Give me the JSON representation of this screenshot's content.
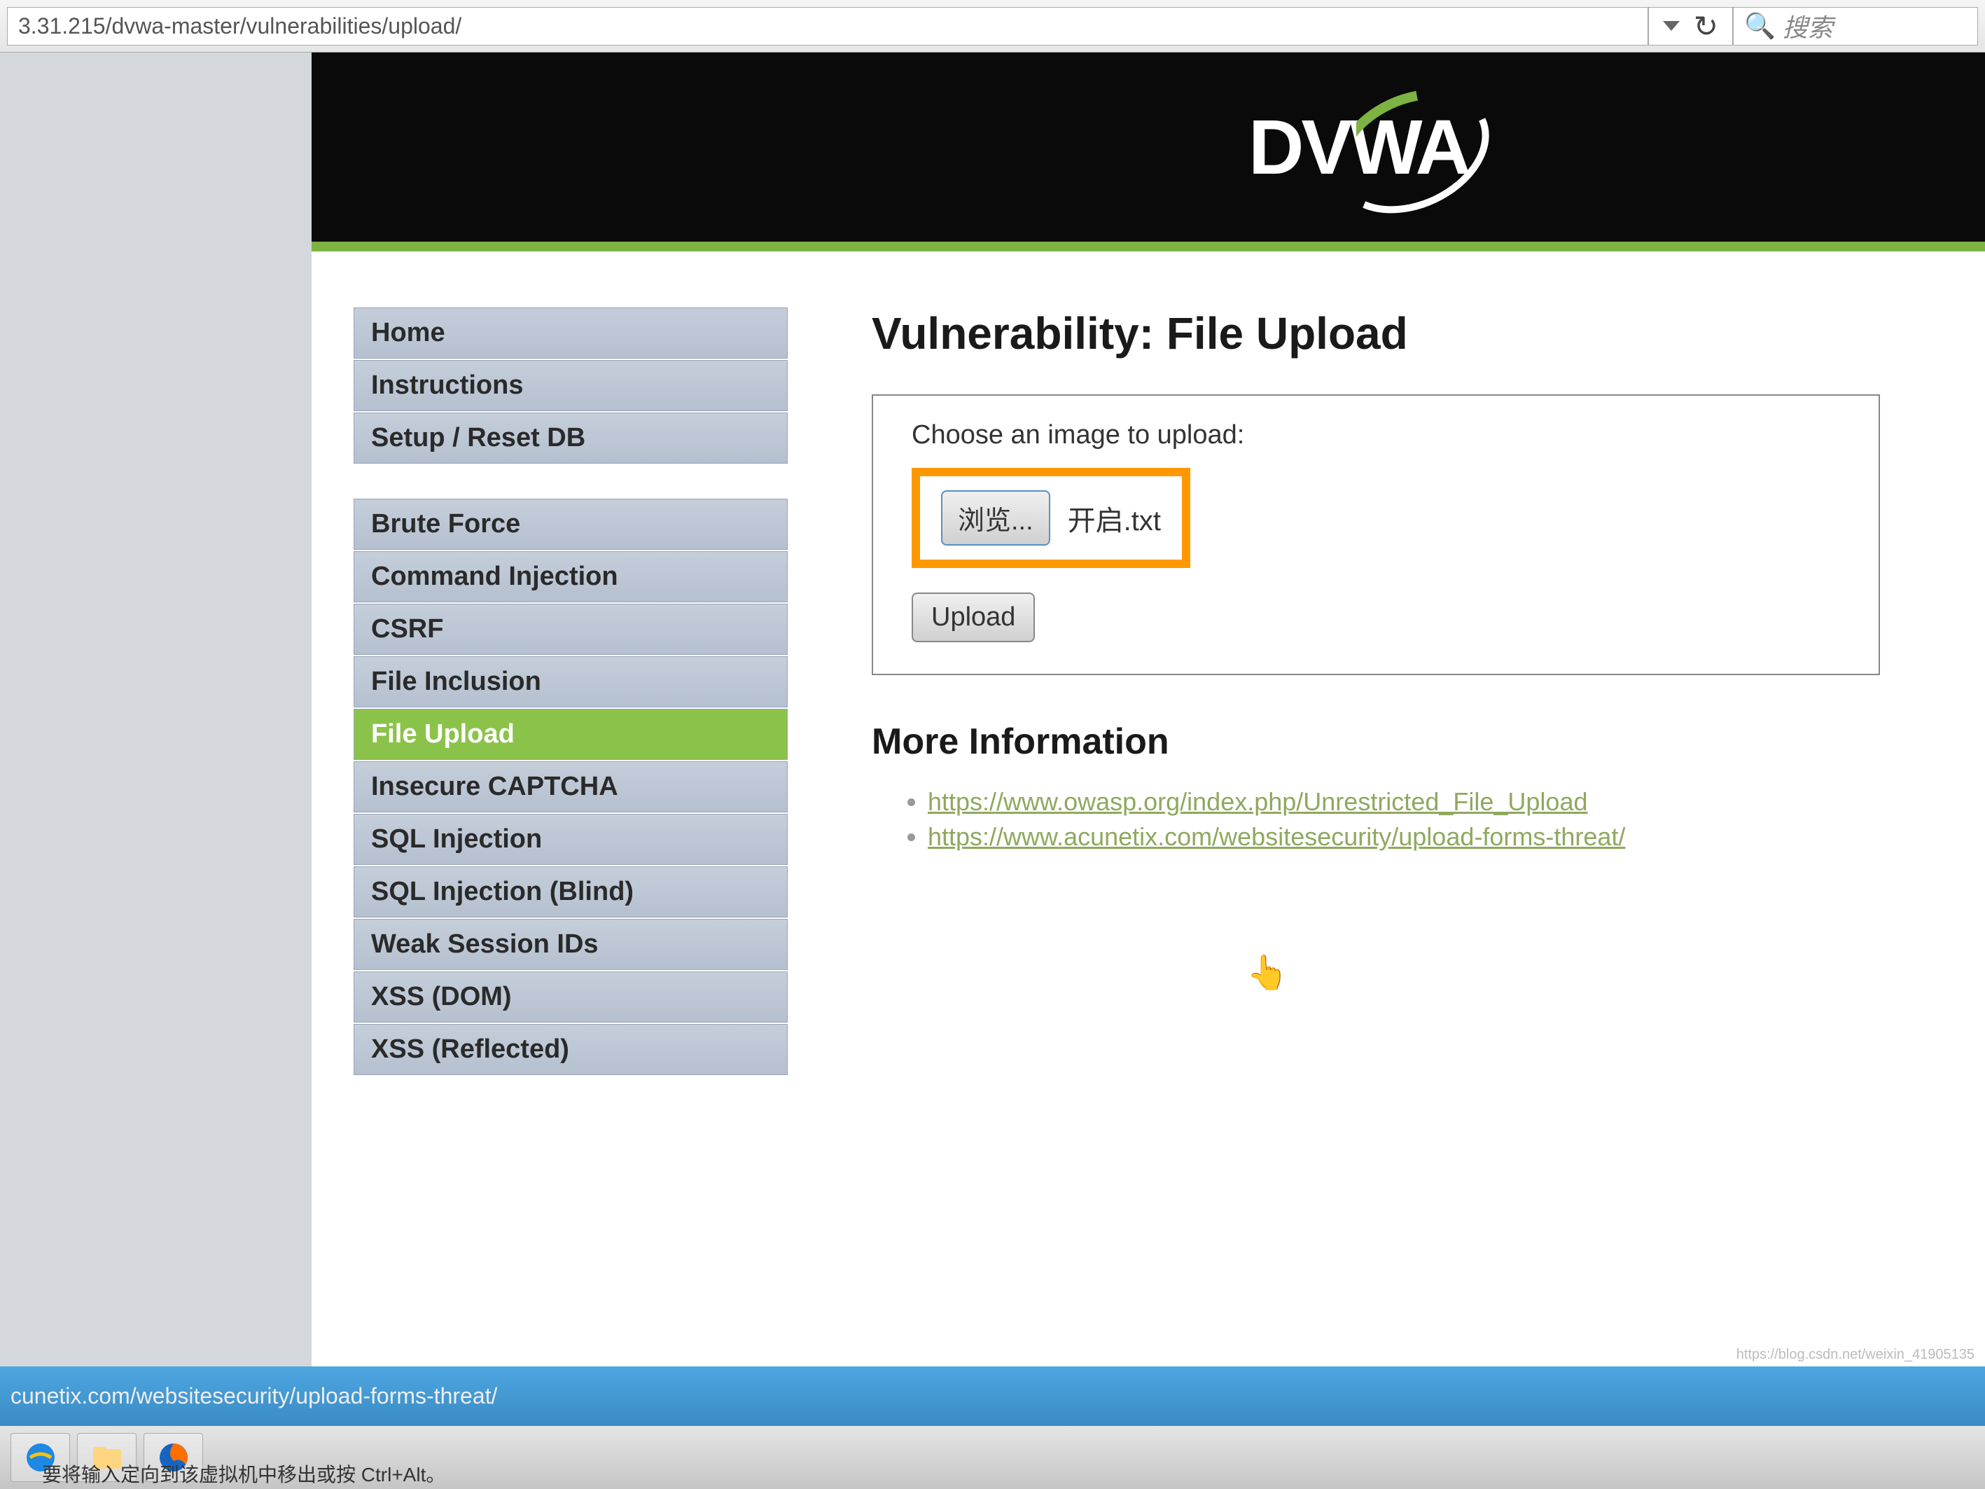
{
  "browser": {
    "url": "3.31.215/dvwa-master/vulnerabilities/upload/",
    "search_placeholder": "搜索"
  },
  "logo": {
    "text": "DVWA"
  },
  "sidebar": {
    "group1": [
      {
        "label": "Home"
      },
      {
        "label": "Instructions"
      },
      {
        "label": "Setup / Reset DB"
      }
    ],
    "group2": [
      {
        "label": "Brute Force"
      },
      {
        "label": "Command Injection"
      },
      {
        "label": "CSRF"
      },
      {
        "label": "File Inclusion"
      },
      {
        "label": "File Upload",
        "active": true
      },
      {
        "label": "Insecure CAPTCHA"
      },
      {
        "label": "SQL Injection"
      },
      {
        "label": "SQL Injection (Blind)"
      },
      {
        "label": "Weak Session IDs"
      },
      {
        "label": "XSS (DOM)"
      },
      {
        "label": "XSS (Reflected)"
      }
    ]
  },
  "main": {
    "title": "Vulnerability: File Upload",
    "form_label": "Choose an image to upload:",
    "browse_label": "浏览...",
    "file_name": "开启.txt",
    "upload_label": "Upload",
    "more_info_title": "More Information",
    "links": [
      "https://www.owasp.org/index.php/Unrestricted_File_Upload",
      "https://www.acunetix.com/websitesecurity/upload-forms-threat/"
    ]
  },
  "statusbar": {
    "text": "cunetix.com/websitesecurity/upload-forms-threat/"
  },
  "watermark": "https://blog.csdn.net/weixin_41905135",
  "hint": "要将输入定向到该虚拟机中移出或按 Ctrl+Alt。"
}
